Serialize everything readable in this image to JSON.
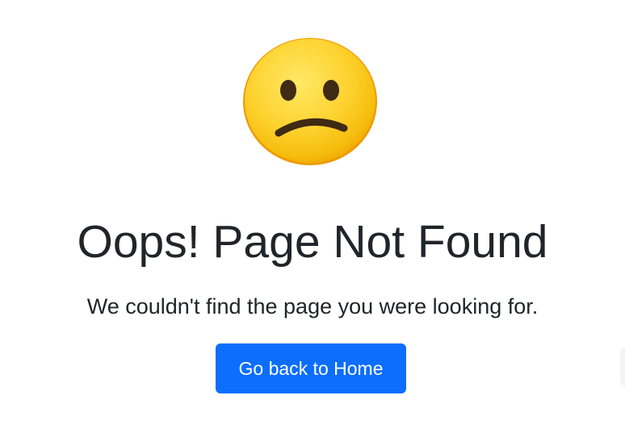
{
  "emoji": {
    "icon": "confused-face-icon",
    "colors": {
      "face_light": "#ffe14d",
      "face_dark": "#f5b800",
      "rim": "#f08c00",
      "features": "#3f2a14"
    }
  },
  "error": {
    "title": "Oops! Page Not Found",
    "message": "We couldn't find the page you were looking for."
  },
  "actions": {
    "home_button_label": "Go back to Home",
    "button_color": "#0d6efd"
  }
}
